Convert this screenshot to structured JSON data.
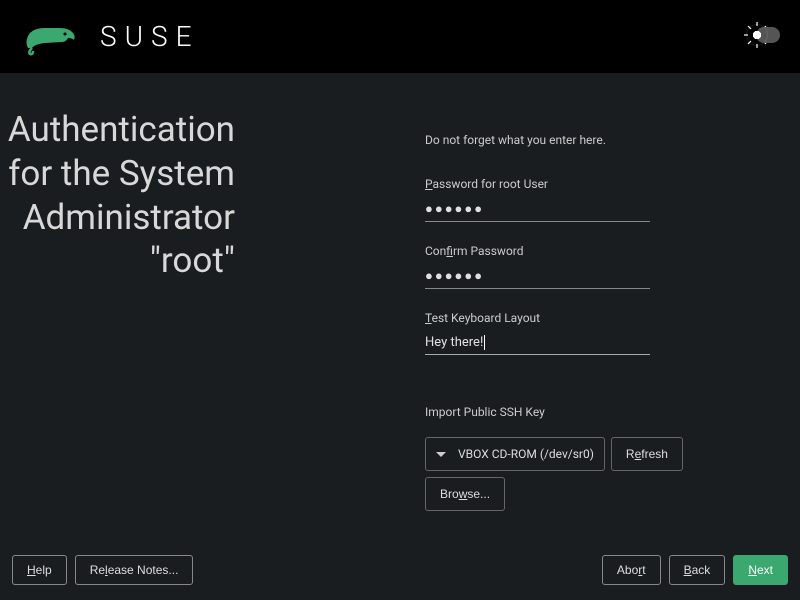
{
  "brand": "SUSE",
  "page_title_lines": [
    "Authentication",
    "for the System",
    "Administrator",
    "\"root\""
  ],
  "hint": "Do not forget what you enter here.",
  "fields": {
    "password": {
      "label_pre": "",
      "label_u": "P",
      "label_post": "assword for root User",
      "value_masked": "●●●●●●"
    },
    "confirm": {
      "label_pre": "Con",
      "label_u": "f",
      "label_post": "irm Password",
      "value_masked": "●●●●●●"
    },
    "keyboard_test": {
      "label_pre": "",
      "label_u": "T",
      "label_post": "est Keyboard Layout",
      "value": "Hey there!"
    }
  },
  "ssh": {
    "label": "Import Public SSH Key",
    "dropdown_value": "VBOX CD-ROM (/dev/sr0)",
    "refresh_pre": "R",
    "refresh_u": "e",
    "refresh_post": "fresh",
    "browse_pre": "Bro",
    "browse_u": "w",
    "browse_post": "se..."
  },
  "footer": {
    "help_u": "H",
    "help_post": "elp",
    "release_pre": "Re",
    "release_u": "l",
    "release_post": "ease Notes...",
    "abort_pre": "Abo",
    "abort_u": "r",
    "abort_post": "t",
    "back_u": "B",
    "back_post": "ack",
    "next_u": "N",
    "next_post": "ext"
  }
}
